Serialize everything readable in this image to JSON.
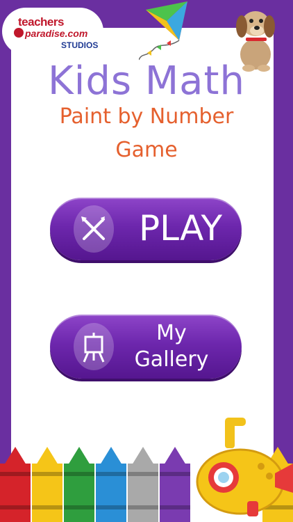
{
  "logo": {
    "line1": "teachers",
    "line2": "paradise.com",
    "line3": "STUDIOS"
  },
  "header": {
    "title": "Kids Math",
    "subtitle_line1": "Paint by Number",
    "subtitle_line2": "Game"
  },
  "buttons": {
    "play_label": "PLAY",
    "gallery_label_line1": "My",
    "gallery_label_line2": "Gallery"
  },
  "colors": {
    "background_purple": "#6a2fa0",
    "title_lavender": "#8d73d6",
    "subtitle_orange": "#e5602e",
    "button_purple": "#6d27ad"
  },
  "icons": {
    "play": "paintbrush-pencil-icon",
    "gallery": "easel-icon"
  }
}
